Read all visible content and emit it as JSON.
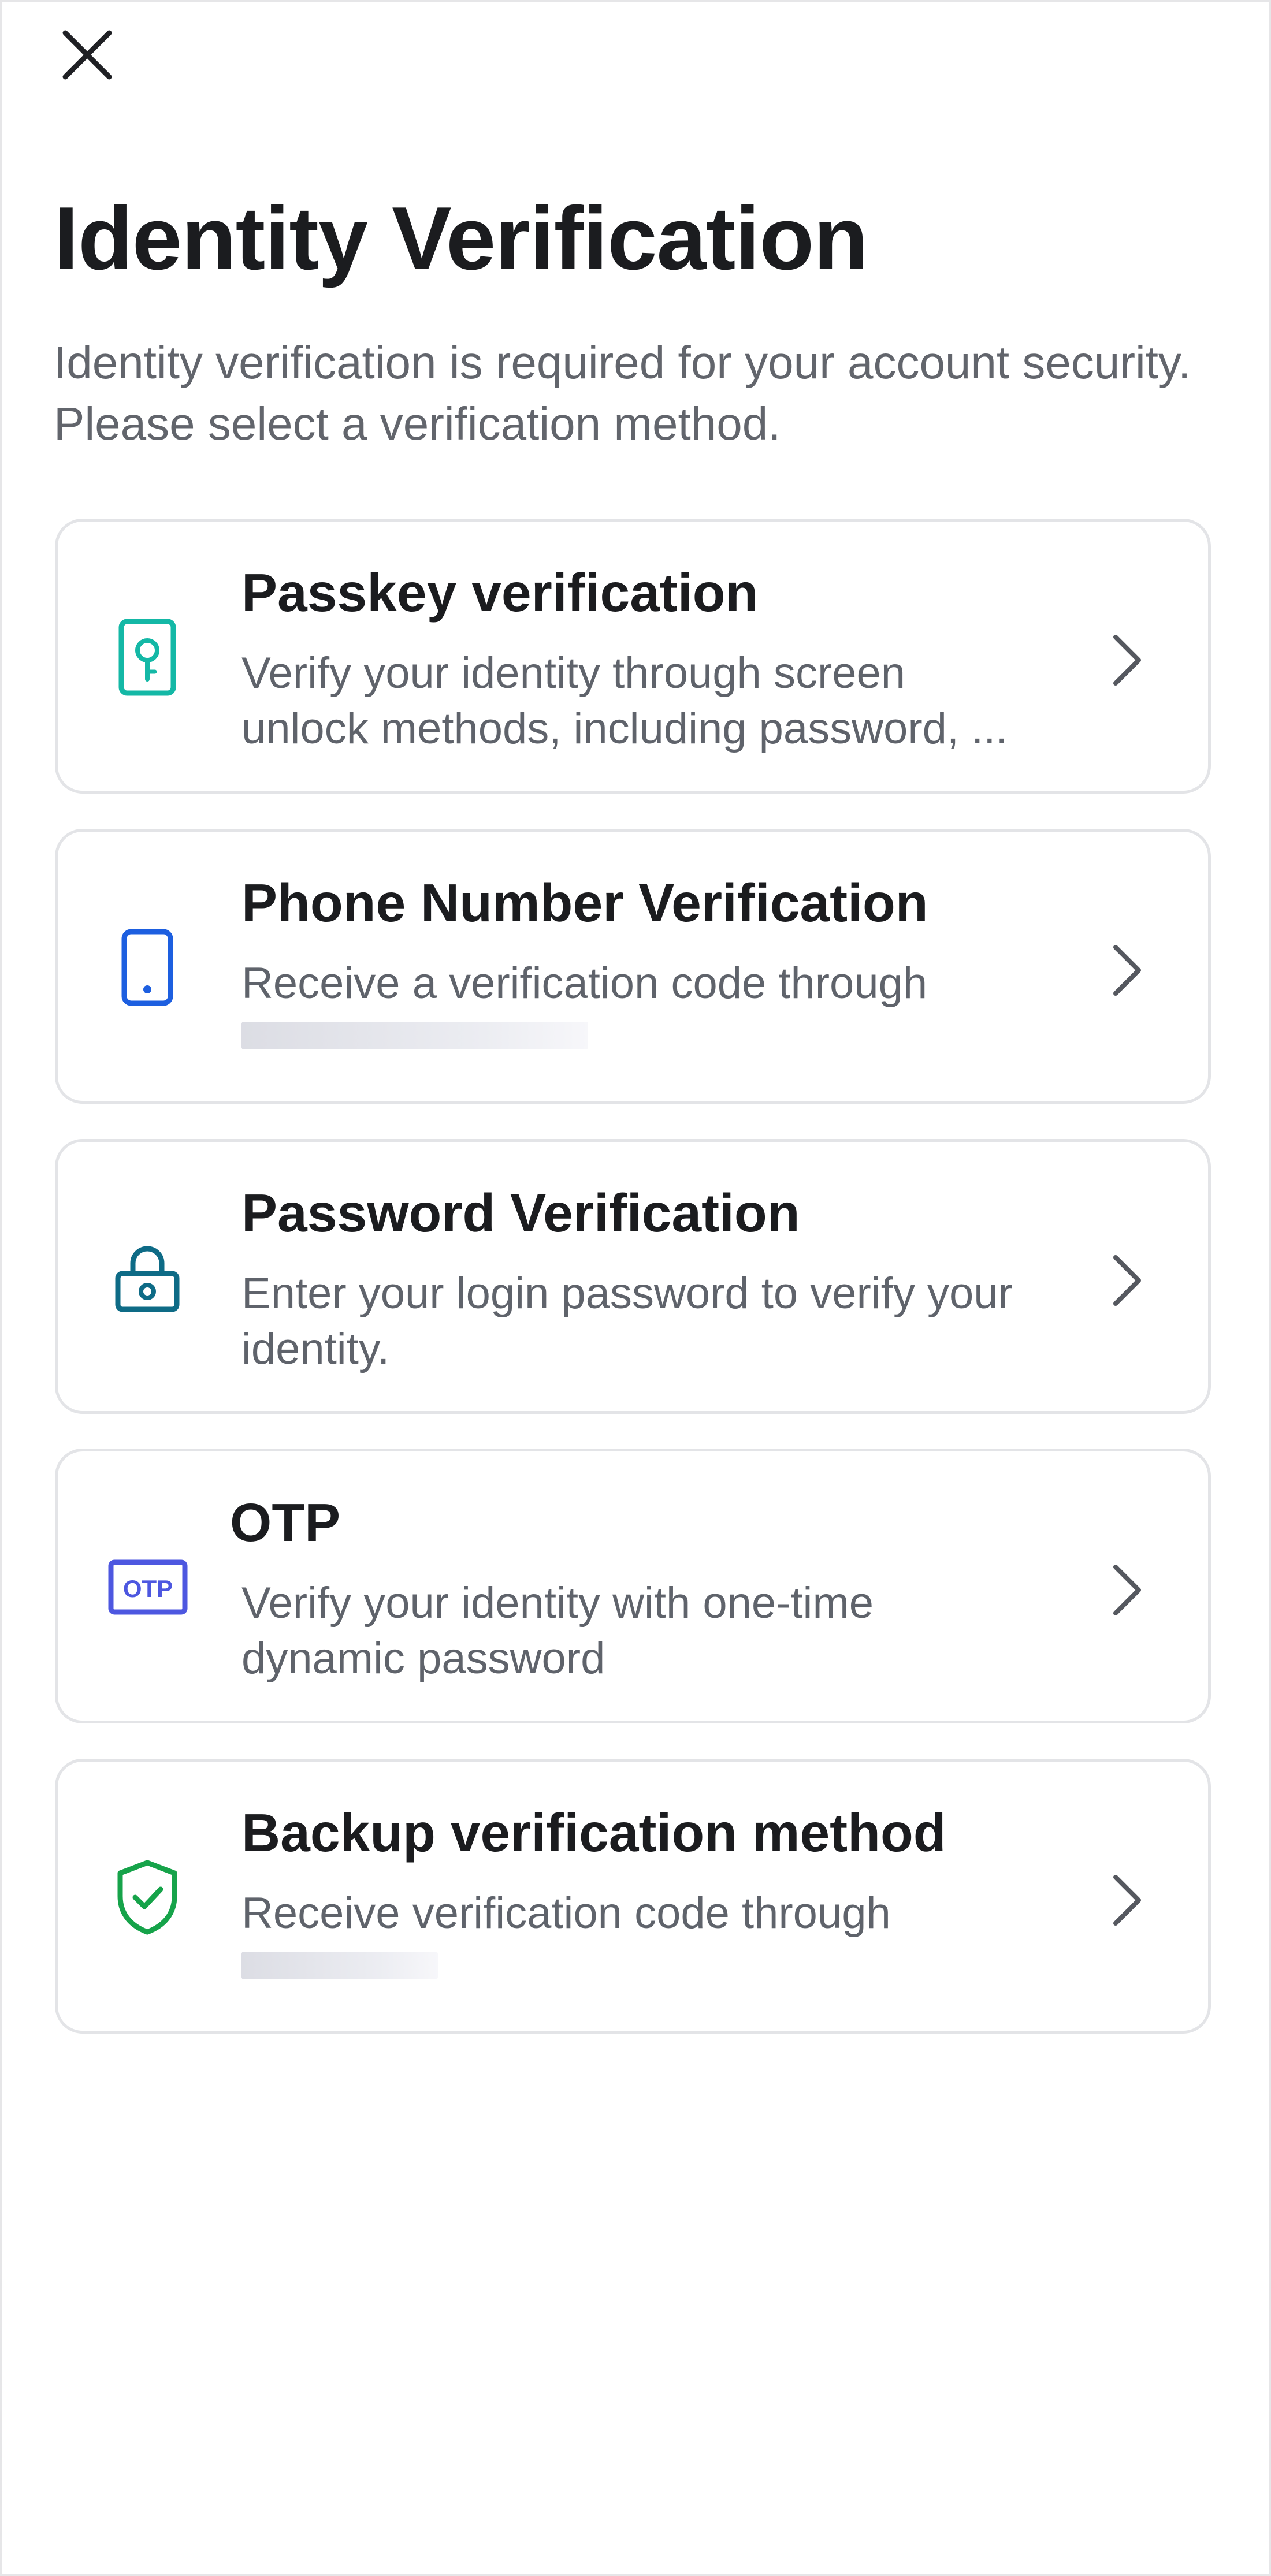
{
  "header": {
    "close_icon": "close-icon",
    "title": "Identity Verification",
    "subtitle": "Identity verification is required for your account security. Please select a verification method."
  },
  "methods": [
    {
      "icon": "passkey-icon",
      "icon_color": "#14b8a6",
      "title": "Passkey verification",
      "desc_lines": [
        "Verify your identity through screen",
        "unlock methods, including password, ..."
      ],
      "redacted": false
    },
    {
      "icon": "phone-icon",
      "icon_color": "#1d5fe0",
      "title": "Phone Number Verification",
      "desc_lines": [
        "Receive a verification code through"
      ],
      "redacted": true,
      "redacted_width_fraction": 0.38
    },
    {
      "icon": "lock-icon",
      "icon_color": "#0e6b86",
      "title": "Password Verification",
      "desc_lines": [
        "Enter your login password to verify your",
        "identity."
      ],
      "redacted": false
    },
    {
      "icon": "otp-icon",
      "icon_color": "#4d57e0",
      "icon_text": "OTP",
      "title": "OTP",
      "desc_lines": [
        "Verify your identity with one-time",
        "dynamic password"
      ],
      "redacted": false
    },
    {
      "icon": "shield-check-icon",
      "icon_color": "#16a34a",
      "title": "Backup verification method",
      "desc_lines": [
        "Receive verification code through"
      ],
      "redacted": true,
      "redacted_width_fraction": 0.21
    }
  ],
  "colors": {
    "title_text": "#1b1c1f",
    "body_text": "#5f636b",
    "card_border": "#e3e4e7",
    "chevron": "#55585f"
  }
}
